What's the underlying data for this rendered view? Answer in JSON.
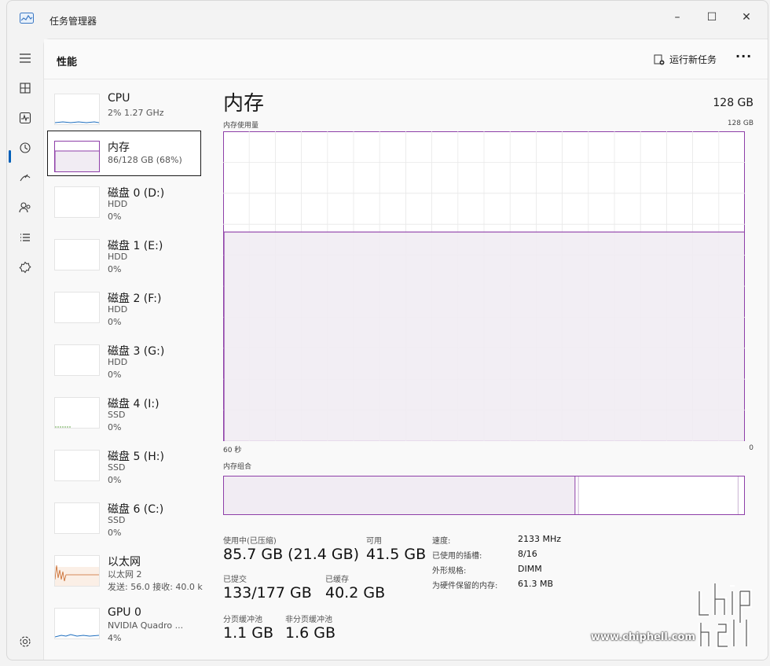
{
  "window": {
    "title": "任务管理器"
  },
  "header": {
    "title": "性能",
    "run_task": "运行新任务",
    "more": "···"
  },
  "controls": {
    "minimize": "–",
    "maximize": "☐",
    "close": "✕"
  },
  "nav": [
    "hamburger-icon",
    "processes-icon",
    "performance-icon",
    "history-icon",
    "startup-icon",
    "users-icon",
    "details-icon",
    "services-icon",
    "settings-icon"
  ],
  "sidebar": {
    "items": [
      {
        "name": "CPU",
        "sub1": "2% 1.27 GHz",
        "sub2": ""
      },
      {
        "name": "内存",
        "sub1": "86/128 GB (68%)",
        "sub2": ""
      },
      {
        "name": "磁盘 0 (D:)",
        "sub1": "HDD",
        "sub2": "0%"
      },
      {
        "name": "磁盘 1 (E:)",
        "sub1": "HDD",
        "sub2": "0%"
      },
      {
        "name": "磁盘 2 (F:)",
        "sub1": "HDD",
        "sub2": "0%"
      },
      {
        "name": "磁盘 3 (G:)",
        "sub1": "HDD",
        "sub2": "0%"
      },
      {
        "name": "磁盘 4 (I:)",
        "sub1": "SSD",
        "sub2": "0%"
      },
      {
        "name": "磁盘 5 (H:)",
        "sub1": "SSD",
        "sub2": "0%"
      },
      {
        "name": "磁盘 6 (C:)",
        "sub1": "SSD",
        "sub2": "0%"
      },
      {
        "name": "以太网",
        "sub1": "以太网 2",
        "sub2": "发送: 56.0 接收: 40.0 k"
      },
      {
        "name": "GPU 0",
        "sub1": "NVIDIA Quadro ...",
        "sub2": "4%"
      }
    ]
  },
  "main": {
    "title": "内存",
    "total": "128 GB",
    "usage_label": "内存使用量",
    "usage_max": "128 GB",
    "x_left": "60 秒",
    "x_right": "0",
    "composition_label": "内存组合",
    "usage_fraction": 0.675,
    "composition": {
      "in_use_fraction": 0.675,
      "modified_fraction": 0.005,
      "standby_fraction": 0.31
    }
  },
  "stats": {
    "in_use_label": "使用中(已压缩)",
    "in_use": "85.7 GB (21.4 GB)",
    "available_label": "可用",
    "available": "41.5 GB",
    "committed_label": "已提交",
    "committed": "133/177 GB",
    "cached_label": "已缓存",
    "cached": "40.2 GB",
    "paged_label": "分页缓冲池",
    "paged": "1.1 GB",
    "nonpaged_label": "非分页缓冲池",
    "nonpaged": "1.6 GB"
  },
  "specs": {
    "speed_label": "速度:",
    "speed": "2133 MHz",
    "slots_label": "已使用的插槽:",
    "slots": "8/16",
    "form_label": "外形规格:",
    "form": "DIMM",
    "reserved_label": "为硬件保留的内存:",
    "reserved": "61.3 MB"
  },
  "watermark": {
    "text": "www.chiphell.com"
  },
  "colors": {
    "memory": "#8e3fa8",
    "memory_fill": "#f1ecf3",
    "accent": "#005fb8"
  }
}
